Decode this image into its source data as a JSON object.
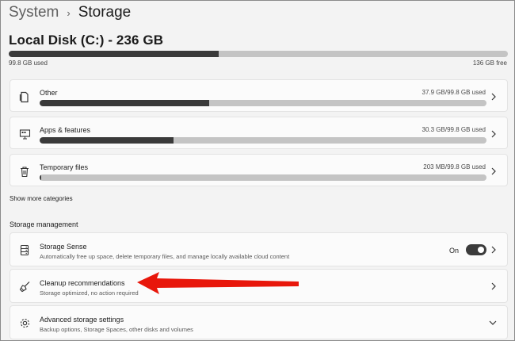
{
  "breadcrumb": {
    "parent": "System",
    "separator": "›",
    "current": "Storage"
  },
  "disk": {
    "title": "Local Disk (C:) - 236 GB",
    "used_label": "99.8 GB used",
    "free_label": "136 GB free",
    "used_fraction": 0.42
  },
  "categories": [
    {
      "label": "Other",
      "value": "37.9 GB/99.8 GB used",
      "fraction": 0.38,
      "icon": "document-icon"
    },
    {
      "label": "Apps & features",
      "value": "30.3 GB/99.8 GB used",
      "fraction": 0.3,
      "icon": "apps-icon"
    },
    {
      "label": "Temporary files",
      "value": "203 MB/99.8 GB used",
      "fraction": 0.002,
      "icon": "trash-icon"
    }
  ],
  "show_more": "Show more categories",
  "management": {
    "title": "Storage management",
    "items": [
      {
        "title": "Storage Sense",
        "desc": "Automatically free up space, delete temporary files, and manage locally available cloud content",
        "toggle_label": "On",
        "toggle_on": true,
        "icon": "storage-icon"
      },
      {
        "title": "Cleanup recommendations",
        "desc": "Storage optimized, no action required",
        "icon": "broom-icon"
      },
      {
        "title": "Advanced storage settings",
        "desc": "Backup options, Storage Spaces, other disks and volumes",
        "icon": "gear-icon"
      }
    ]
  },
  "annotation": {
    "arrow_color": "#e8170b"
  }
}
